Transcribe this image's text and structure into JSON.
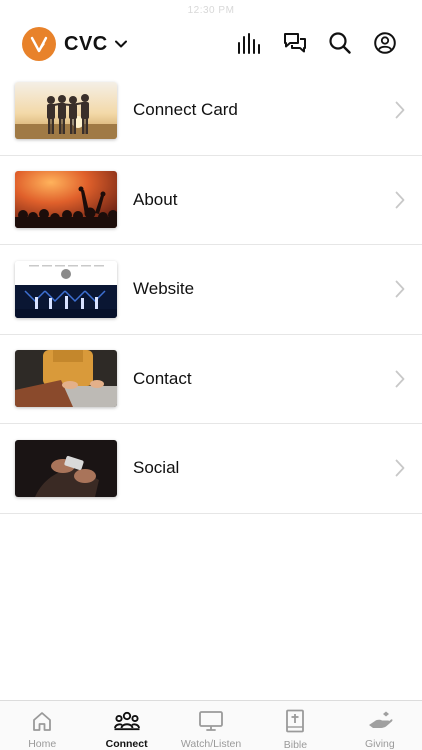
{
  "status_bar": {
    "time": "12:30 PM"
  },
  "header": {
    "org_name": "CVC",
    "logo_color": "#e8822a",
    "icons": [
      "bar-chart-icon",
      "chat-icon",
      "search-icon",
      "profile-icon"
    ]
  },
  "list": {
    "items": [
      {
        "label": "Connect Card",
        "thumbnail": "friends-sunset-image"
      },
      {
        "label": "About",
        "thumbnail": "worship-concert-image"
      },
      {
        "label": "Website",
        "thumbnail": "website-screenshot-image"
      },
      {
        "label": "Contact",
        "thumbnail": "laptop-typing-image"
      },
      {
        "label": "Social",
        "thumbnail": "phone-hands-image"
      }
    ]
  },
  "tabbar": {
    "active": "Connect",
    "tabs": [
      {
        "label": "Home",
        "icon": "home-icon"
      },
      {
        "label": "Connect",
        "icon": "people-icon"
      },
      {
        "label": "Watch/Listen",
        "icon": "tv-icon"
      },
      {
        "label": "Bible",
        "icon": "bible-icon"
      },
      {
        "label": "Giving",
        "icon": "giving-hand-icon"
      }
    ]
  },
  "colors": {
    "accent": "#e8822a",
    "text": "#111111",
    "inactive": "#9a9a9a",
    "divider": "#e6e6e6"
  }
}
